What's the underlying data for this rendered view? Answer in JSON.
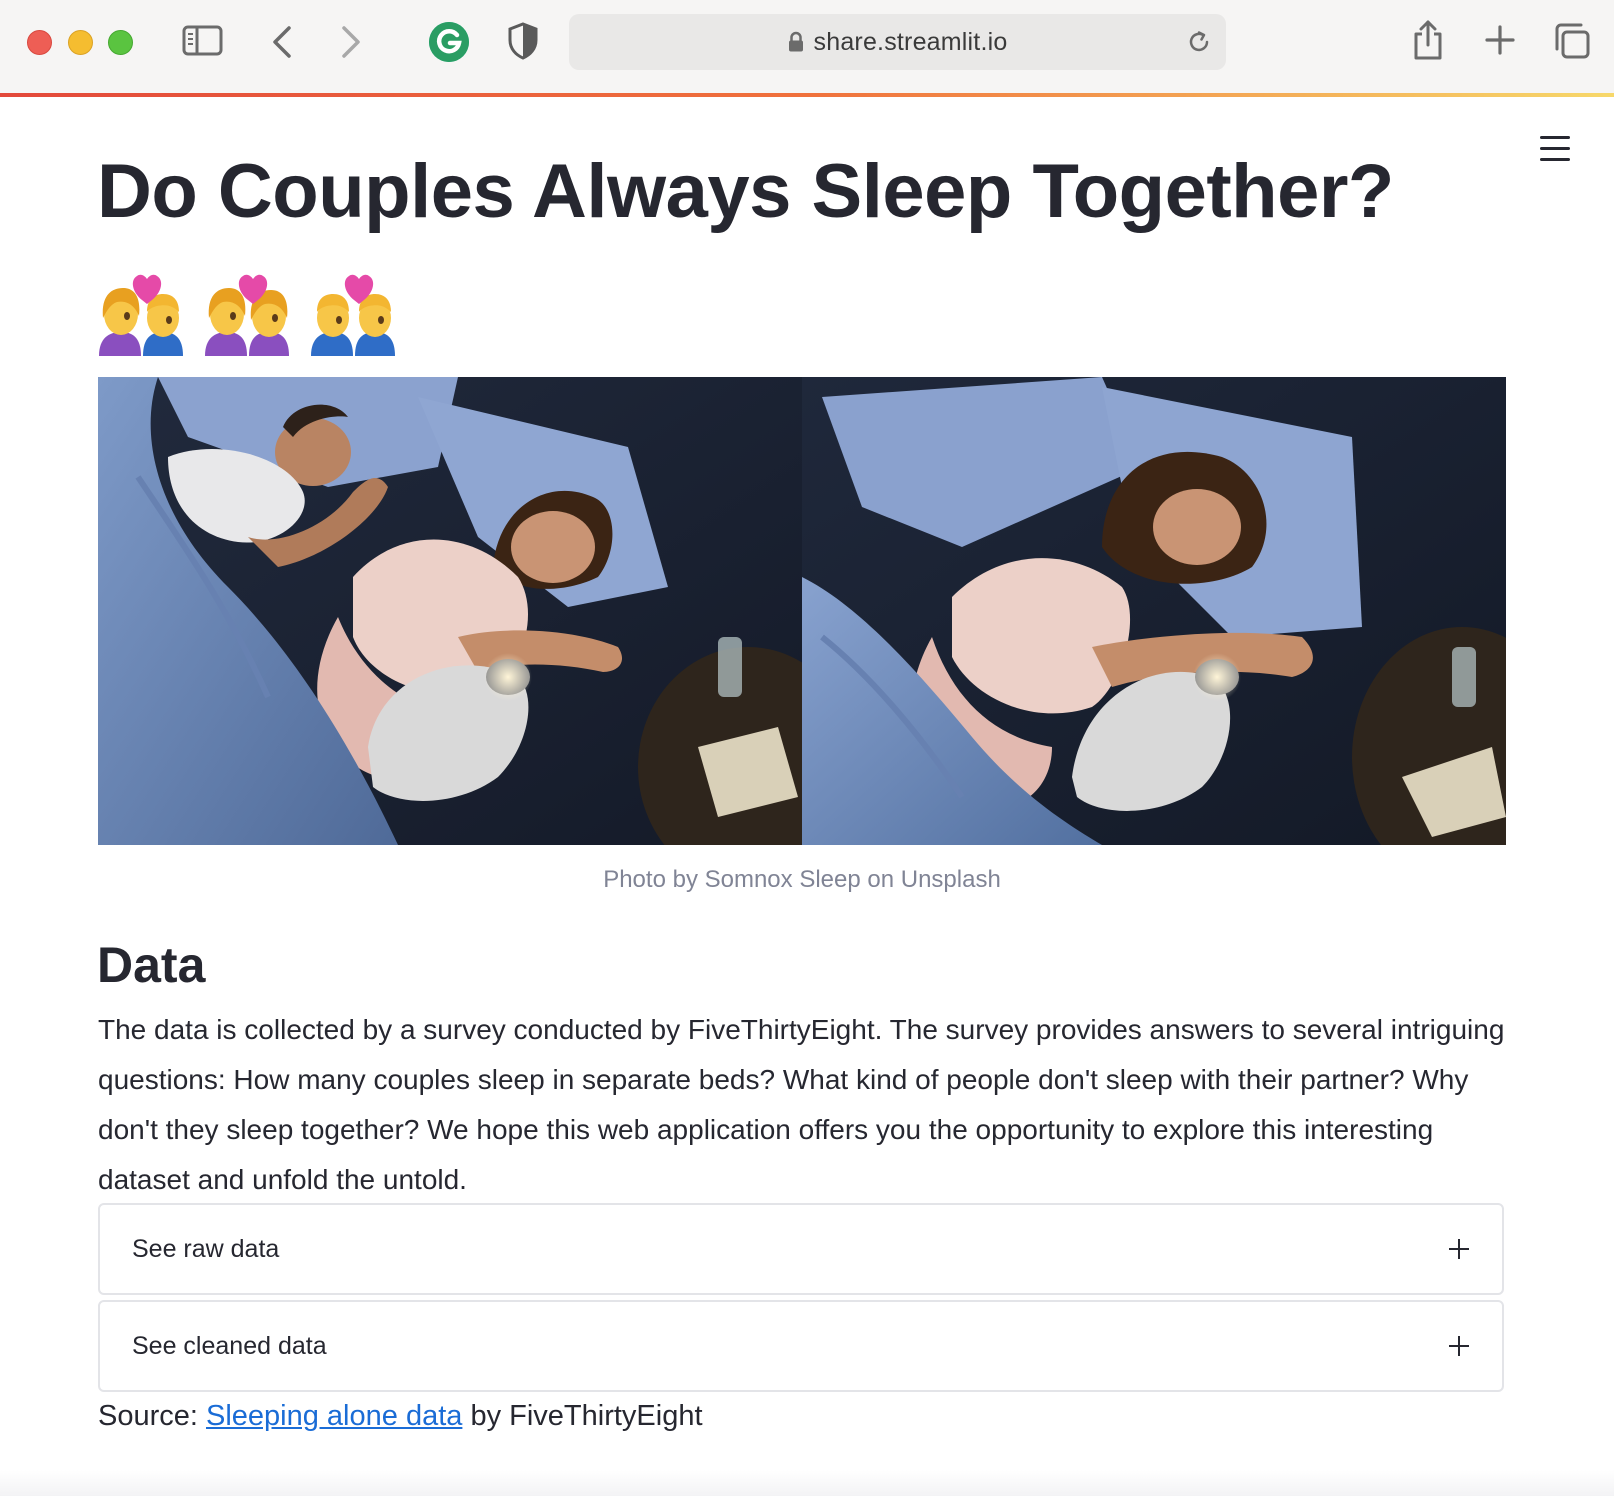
{
  "browser": {
    "url": "share.streamlit.io",
    "window_controls": {
      "close_color": "#ee5e55",
      "minimize_color": "#f5bd30",
      "maximize_color": "#5ac440"
    },
    "toolbar_icons": [
      "sidebar-icon",
      "back-icon",
      "forward-icon",
      "grammarly-icon",
      "shield-icon",
      "lock-icon",
      "reload-icon",
      "share-icon",
      "new-tab-icon",
      "tabs-overview-icon"
    ]
  },
  "app": {
    "menu_icon": "hamburger-menu-icon",
    "title": "Do Couples Always Sleep Together?",
    "emojis": [
      "couple-with-heart-woman-man",
      "couple-with-heart-woman-woman",
      "couple-with-heart-man-man"
    ],
    "image_caption": "Photo by Somnox Sleep on Unsplash",
    "data_section": {
      "heading": "Data",
      "description": "The data is collected by a survey conducted by FiveThirtyEight. The survey provides answers to several intriguing questions: How many couples sleep in separate beds? What kind of people don't sleep with their partner? Why don't they sleep together? We hope this web application offers you the opportunity to explore this interesting dataset and unfold the untold.",
      "expanders": [
        {
          "label": "See raw data",
          "icon": "plus-icon"
        },
        {
          "label": "See cleaned data",
          "icon": "plus-icon"
        }
      ],
      "source": {
        "prefix": "Source: ",
        "link_text": "Sleeping alone data",
        "suffix": " by FiveThirtyEight",
        "link_color": "#1a6cd6"
      }
    }
  },
  "colors": {
    "text": "#262730",
    "caption": "#808495",
    "border": "#e3e4e8",
    "accent_gradient": [
      "#e3493b",
      "#f0713c",
      "#f7d86a"
    ]
  }
}
